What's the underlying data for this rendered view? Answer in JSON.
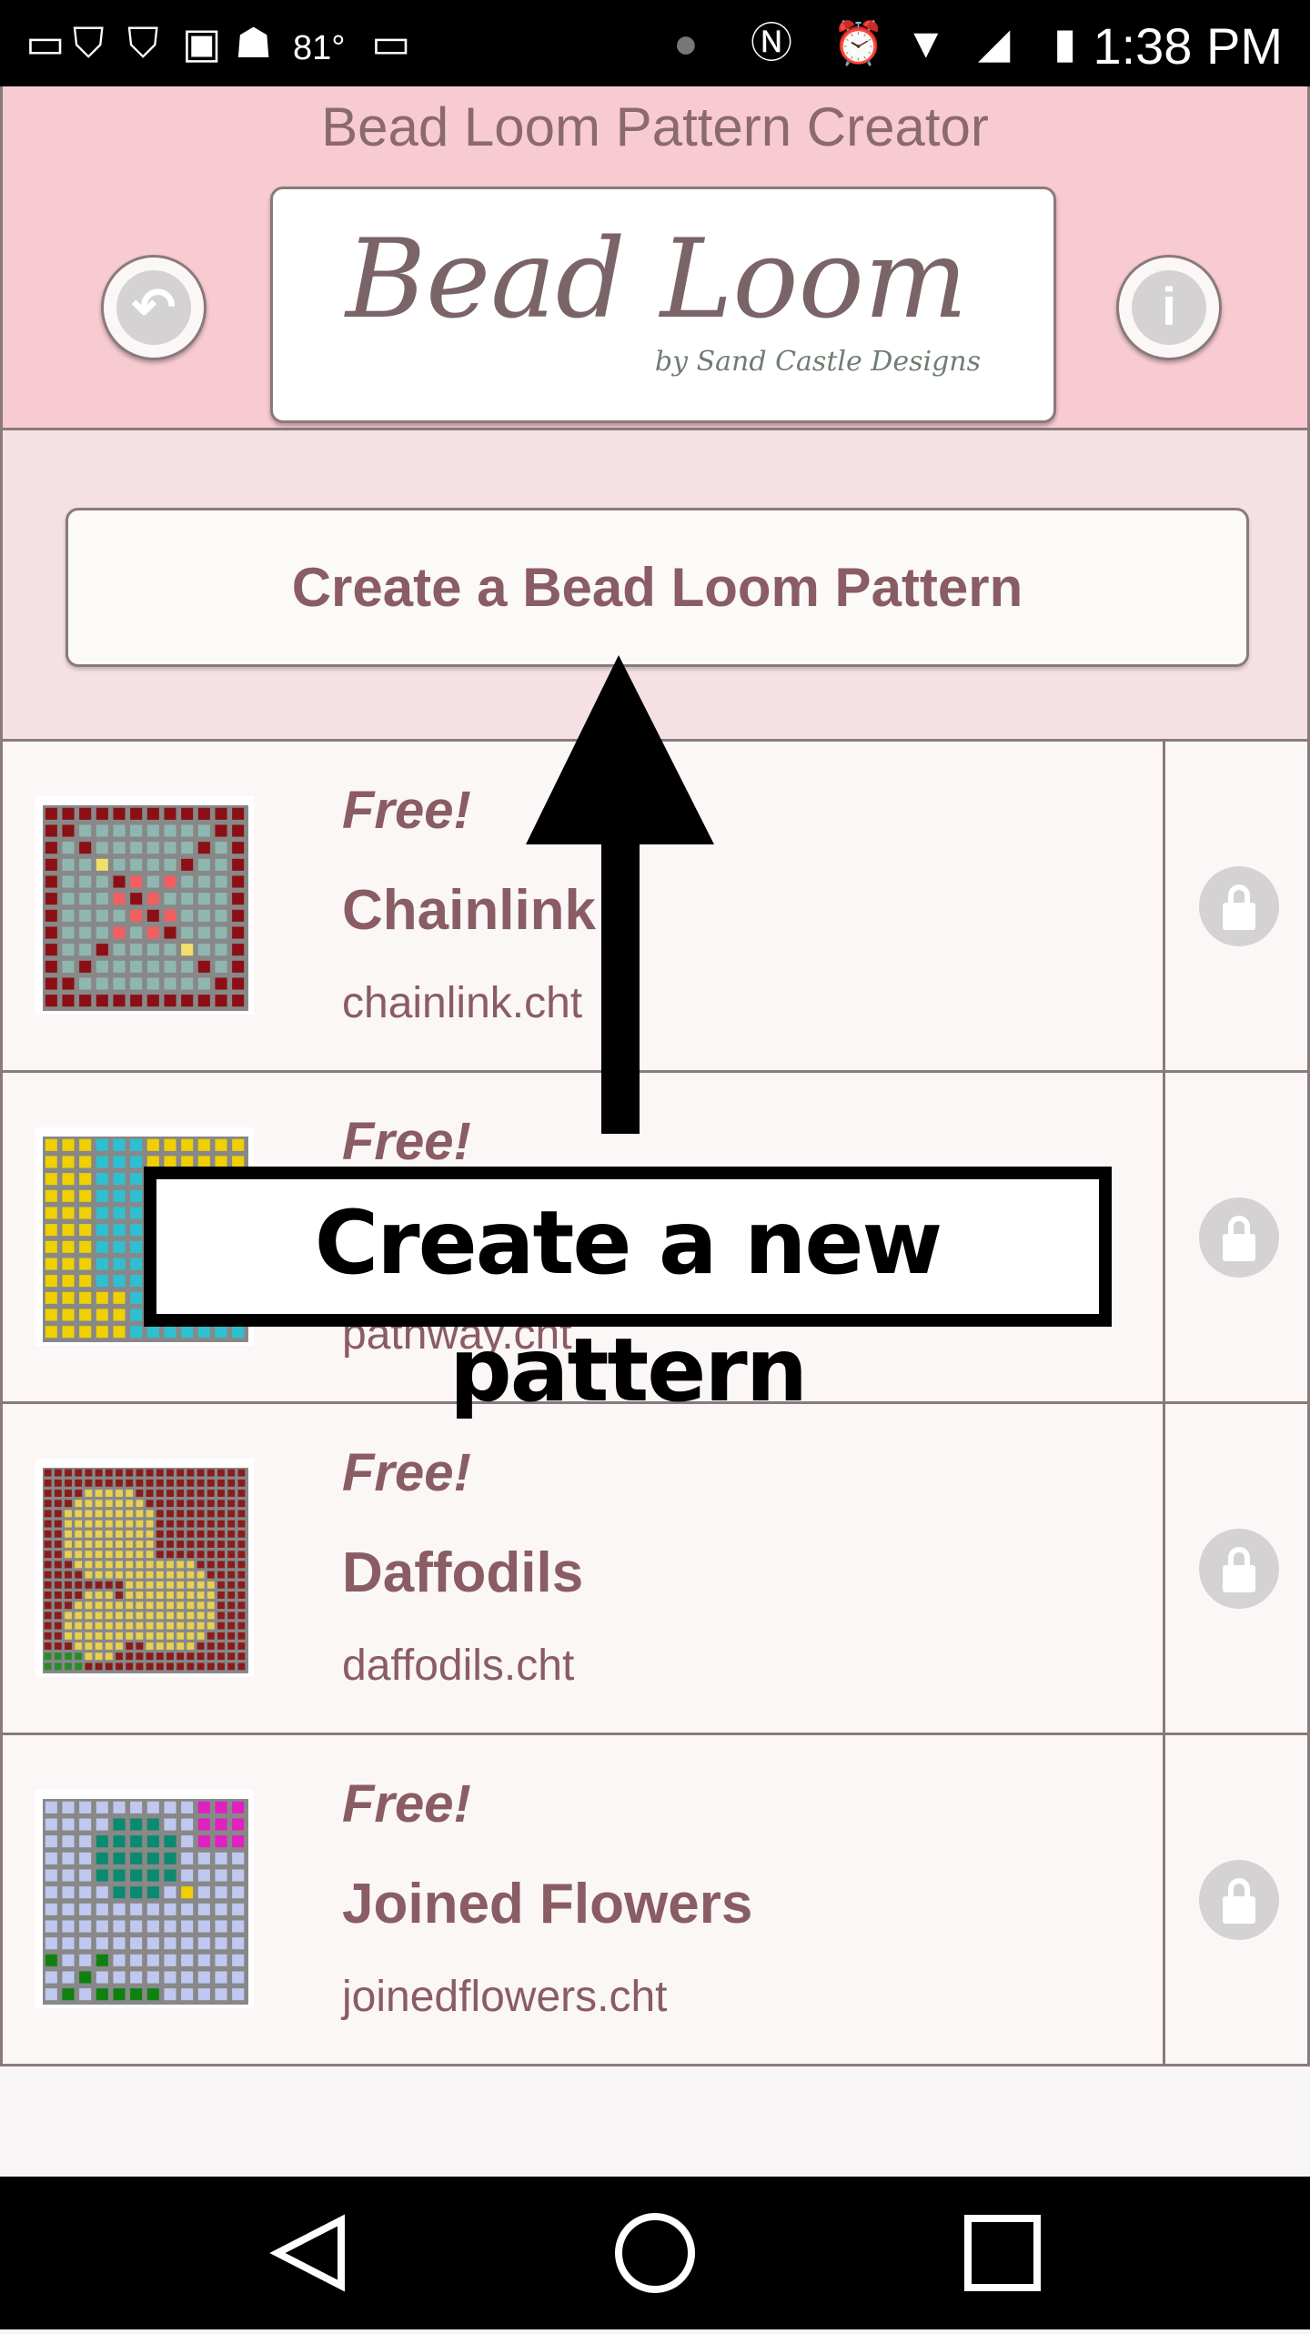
{
  "status_bar": {
    "temperature": "81°",
    "time": "1:38 PM"
  },
  "header": {
    "title": "Bead Loom Pattern Creator",
    "logo_text": "Bead Loom",
    "logo_subtext": "by Sand Castle Designs"
  },
  "create_button": "Create a Bead Loom Pattern",
  "patterns": [
    {
      "badge": "Free!",
      "name": "Chainlink",
      "file": "chainlink.cht",
      "colors": [
        "#8fb7b0",
        "#8b0f14",
        "#f0e06a",
        "#f06060"
      ]
    },
    {
      "badge": "Free!",
      "name": "",
      "file": "pathway.cht",
      "colors": [
        "#f0d000",
        "#2ec0d0",
        "#c8c8ff"
      ]
    },
    {
      "badge": "Free!",
      "name": "Daffodils",
      "file": "daffodils.cht",
      "colors": [
        "#8b1a1a",
        "#e8d050",
        "#e0c060",
        "#2a8a2a"
      ]
    },
    {
      "badge": "Free!",
      "name": "Joined Flowers",
      "file": "joinedflowers.cht",
      "colors": [
        "#c0c8f0",
        "#0a8a70",
        "#e020c0",
        "#108010",
        "#f0d000"
      ]
    }
  ],
  "annotation": {
    "label": "Create a new pattern"
  }
}
